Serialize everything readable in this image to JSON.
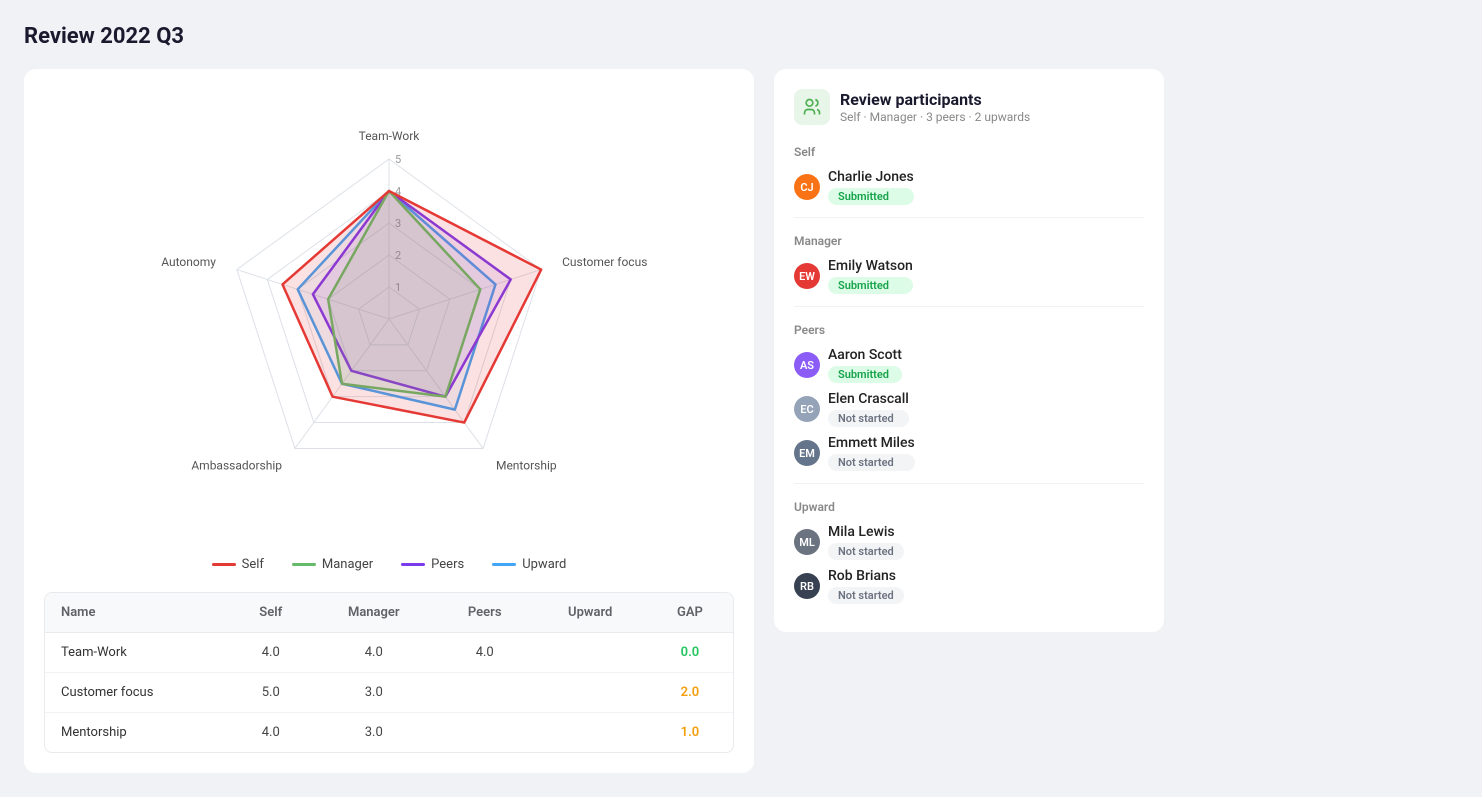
{
  "page": {
    "title": "Review 2022 Q3"
  },
  "chart": {
    "axes": [
      "Team-Work",
      "Customer focus",
      "Mentorship",
      "Ambassadorship",
      "Autonomy"
    ],
    "scale_max": 5,
    "scale_labels": [
      1,
      2,
      3,
      4,
      5
    ],
    "series": {
      "self": [
        4,
        5,
        4,
        3,
        3.5
      ],
      "manager": [
        4,
        3,
        3,
        2.5,
        2
      ],
      "peers": [
        4,
        4,
        3,
        2,
        2.5
      ],
      "upward": [
        4,
        3.5,
        3.5,
        2.5,
        3
      ]
    },
    "colors": {
      "self": "#e53935",
      "manager": "#66bb6a",
      "peers": "#7c3aed",
      "upward": "#42a5f5"
    }
  },
  "legend": [
    {
      "key": "self",
      "label": "Self",
      "color": "#e53935"
    },
    {
      "key": "manager",
      "label": "Manager",
      "color": "#66bb6a"
    },
    {
      "key": "peers",
      "label": "Peers",
      "color": "#7c3aed"
    },
    {
      "key": "upward",
      "label": "Upward",
      "color": "#42a5f5"
    }
  ],
  "table": {
    "headers": [
      "Name",
      "Self",
      "Manager",
      "Peers",
      "Upward",
      "GAP"
    ],
    "rows": [
      {
        "name": "Team-Work",
        "self": "4.0",
        "manager": "4.0",
        "peers": "4.0",
        "upward": "",
        "gap": "0.0",
        "gap_class": "gap-0"
      },
      {
        "name": "Customer focus",
        "self": "5.0",
        "manager": "3.0",
        "peers": "",
        "upward": "",
        "gap": "2.0",
        "gap_class": "gap-2"
      },
      {
        "name": "Mentorship",
        "self": "4.0",
        "manager": "3.0",
        "peers": "",
        "upward": "",
        "gap": "1.0",
        "gap_class": "gap-1"
      }
    ]
  },
  "participants": {
    "title": "Review participants",
    "subtitle": "Self · Manager · 3 peers · 2 upwards",
    "sections": [
      {
        "label": "Self",
        "people": [
          {
            "name": "Charlie Jones",
            "status": "Submitted",
            "status_type": "submitted",
            "color": "#f97316"
          }
        ]
      },
      {
        "label": "Manager",
        "people": [
          {
            "name": "Emily Watson",
            "status": "Submitted",
            "status_type": "submitted",
            "color": "#e53935"
          }
        ]
      },
      {
        "label": "Peers",
        "people": [
          {
            "name": "Aaron Scott",
            "status": "Submitted",
            "status_type": "submitted",
            "color": "#8b5cf6"
          },
          {
            "name": "Elen Crascall",
            "status": "Not started",
            "status_type": "not-started",
            "color": "#94a3b8"
          },
          {
            "name": "Emmett Miles",
            "status": "Not started",
            "status_type": "not-started",
            "color": "#64748b"
          }
        ]
      },
      {
        "label": "Upward",
        "people": [
          {
            "name": "Mila Lewis",
            "status": "Not started",
            "status_type": "not-started",
            "color": "#6b7280"
          },
          {
            "name": "Rob Brians",
            "status": "Not started",
            "status_type": "not-started",
            "color": "#374151"
          }
        ]
      }
    ]
  }
}
